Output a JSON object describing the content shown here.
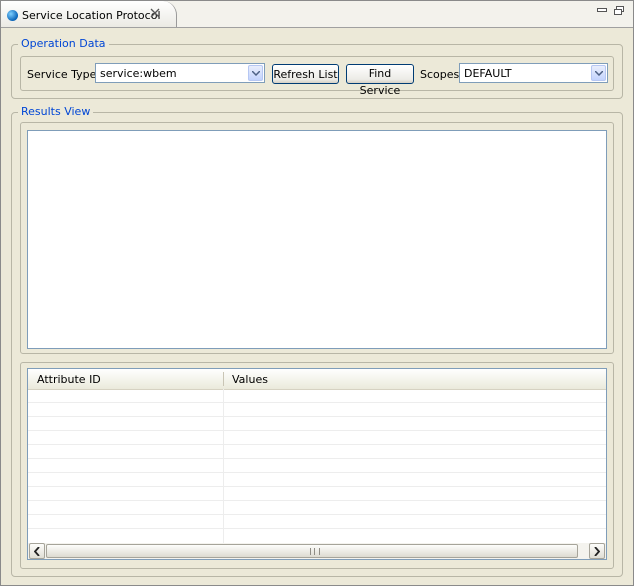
{
  "view": {
    "tab_title": "Service Location Protocol",
    "close_glyph": "☒",
    "minimize_glyph": "▁",
    "maximize_glyph": "⧉"
  },
  "operation_data": {
    "group_title": "Operation Data",
    "service_type_label": "Service Type",
    "service_type_value": "service:wbem",
    "refresh_label": "Refresh List",
    "find_label": "Find Service",
    "scopes_label": "Scopes",
    "scopes_value": "DEFAULT"
  },
  "results_view": {
    "group_title": "Results View",
    "columns": [
      "Attribute ID",
      "Values"
    ],
    "scroll_grip": "III"
  },
  "colors": {
    "group_title": "#0046d5",
    "panel_bg": "#ece9d8",
    "field_border": "#7f9db9"
  }
}
